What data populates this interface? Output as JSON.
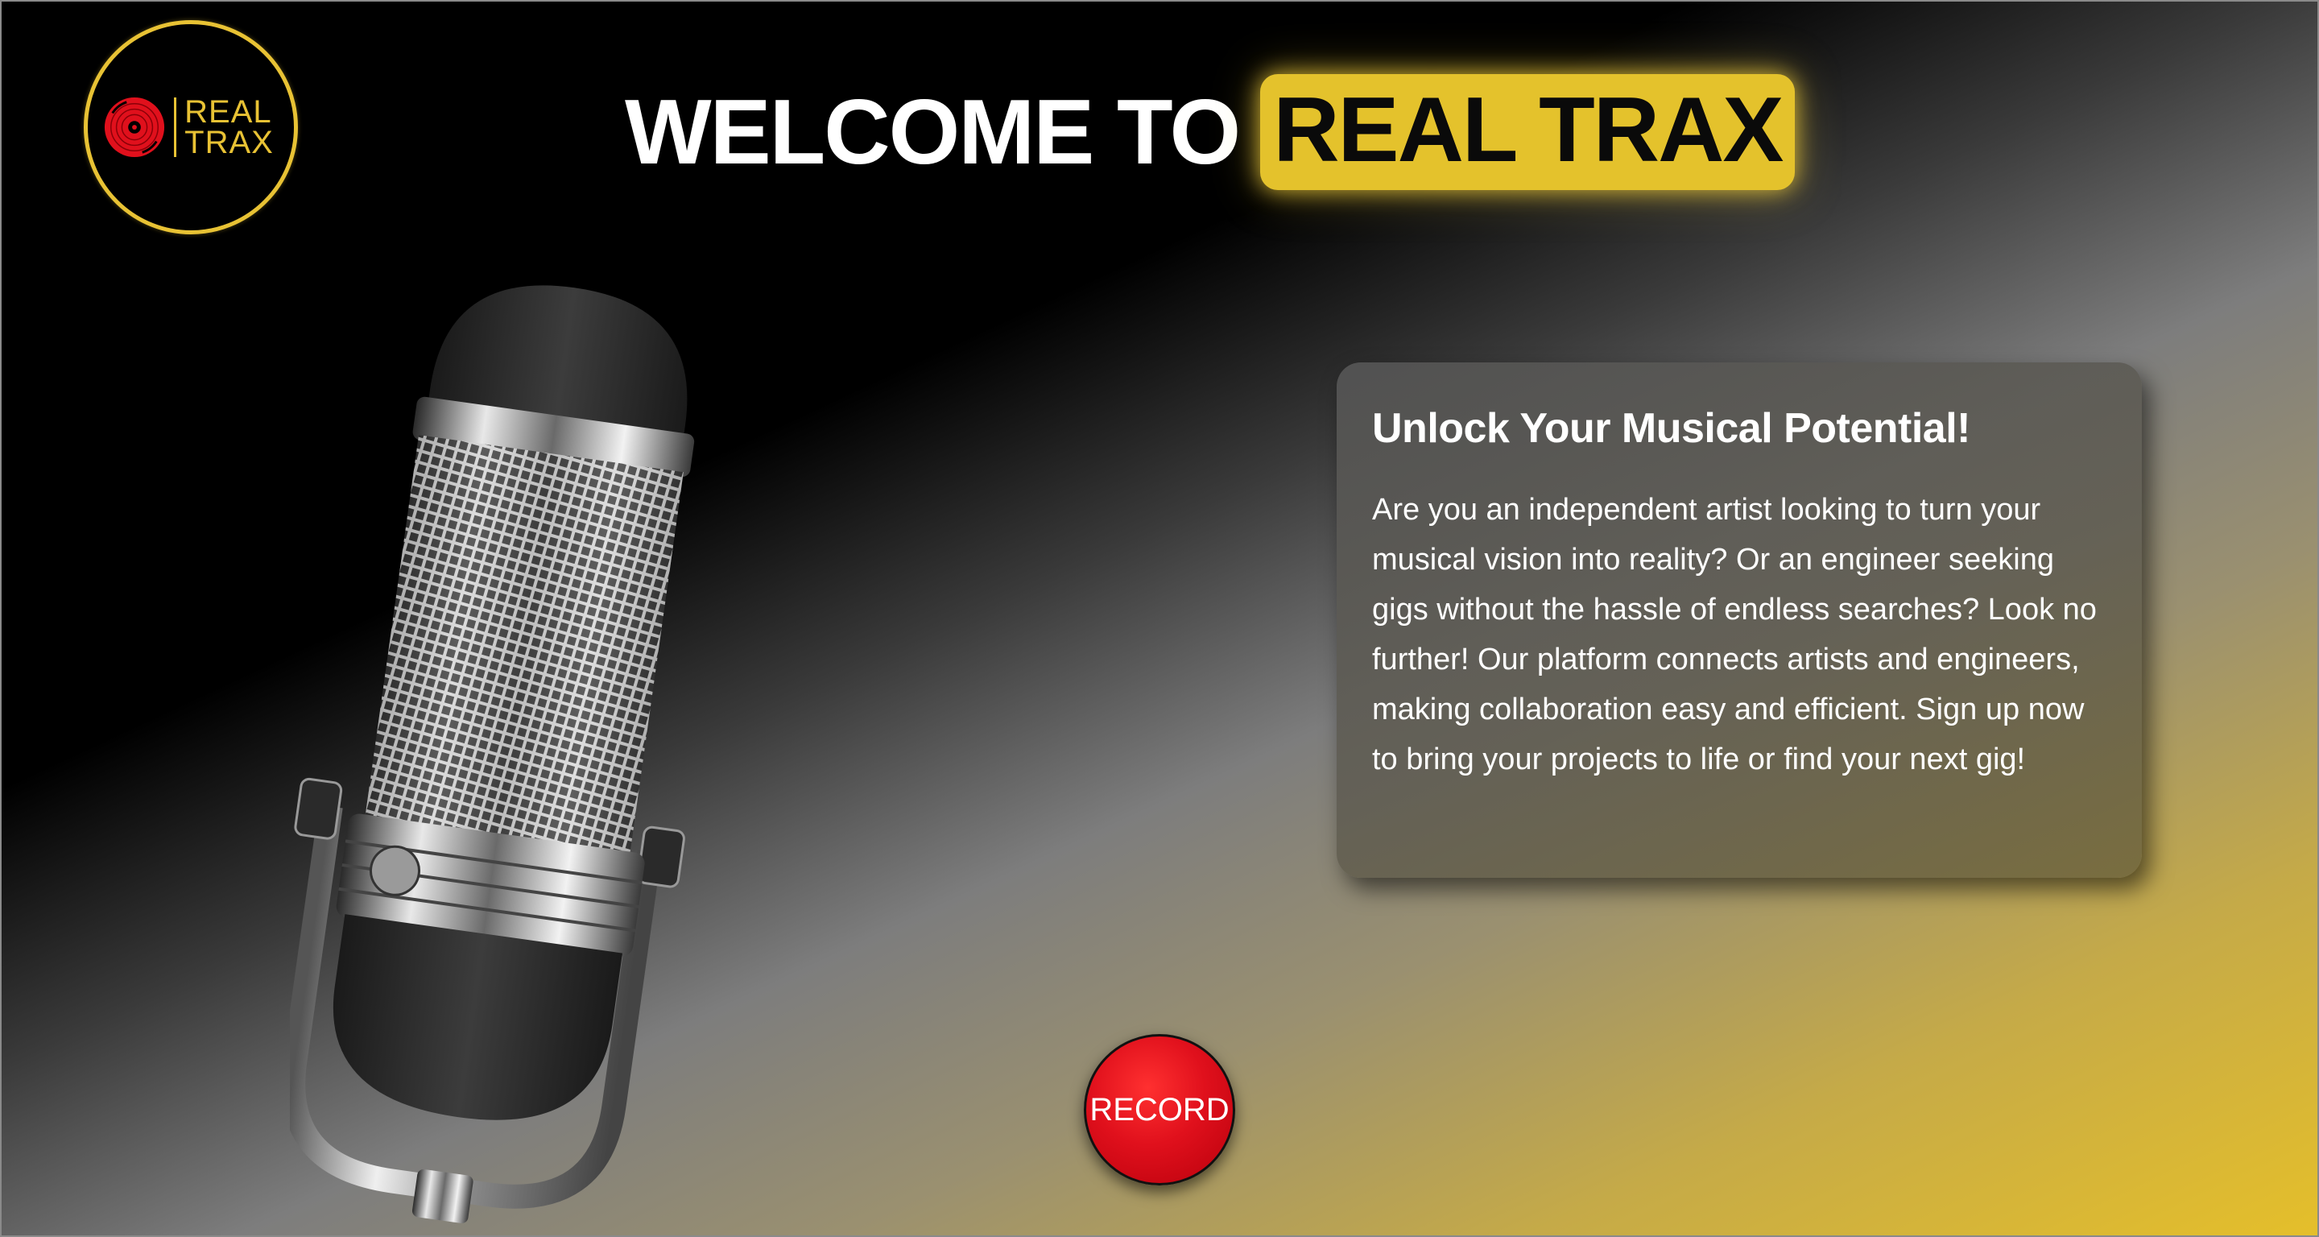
{
  "logo": {
    "line1": "REAL",
    "line2": "TRAX",
    "icon": "vinyl-record-icon",
    "accent_color": "#e8c234",
    "disc_color": "#e0101c"
  },
  "hero": {
    "title_prefix": "WELCOME TO",
    "title_highlight": "REAL TRAX",
    "highlight_color": "#e4c22c"
  },
  "card": {
    "title": "Unlock Your Musical Potential!",
    "body": "Are you an independent artist looking to turn your musical vision into reality? Or an engineer seeking gigs without the hassle of endless searches? Look no further! Our platform connects artists and engineers, making collaboration easy and efficient. Sign up now to bring your projects to life or find your next gig!"
  },
  "record_button": {
    "label": "RECORD",
    "color": "#e0101c"
  },
  "hero_image": {
    "icon": "microphone-icon"
  }
}
